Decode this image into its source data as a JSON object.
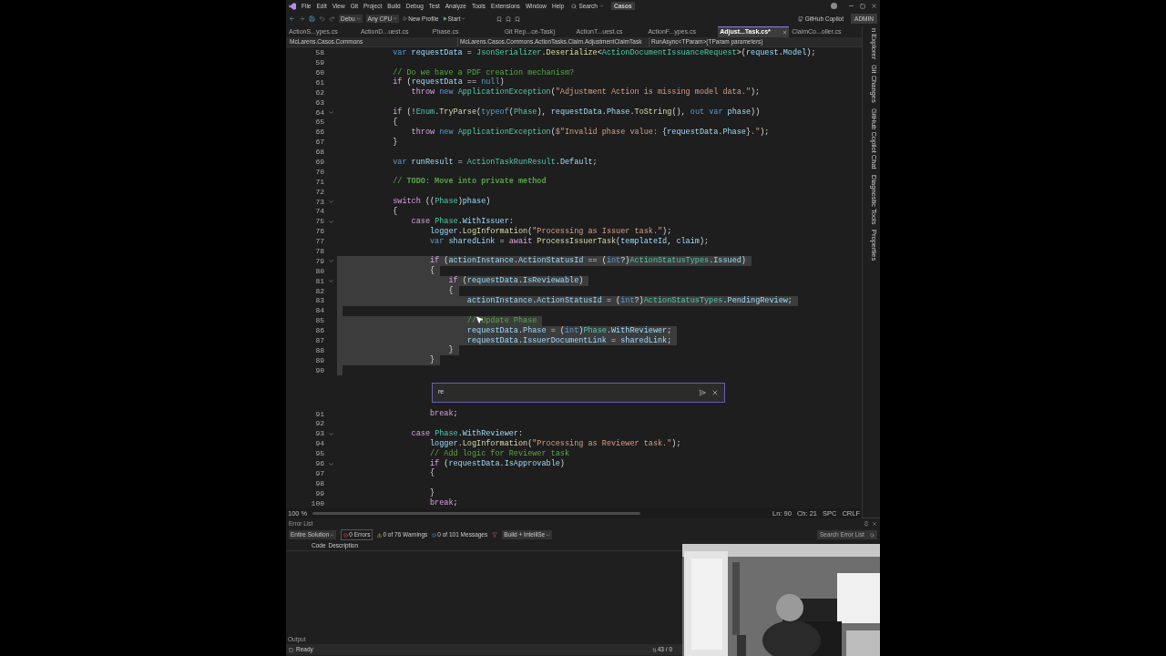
{
  "menu": [
    "File",
    "Edit",
    "View",
    "Git",
    "Project",
    "Build",
    "Debug",
    "Test",
    "Analyze",
    "Tools",
    "Extensions",
    "Window",
    "Help"
  ],
  "search": "Search",
  "solution_name": "Casos",
  "toolbar": {
    "configuration": "Debu",
    "platform": "Any CPU",
    "profile": "New Profile",
    "start": "Start",
    "copilot": "GitHub Copilot",
    "account": "ADMIN"
  },
  "tabs": [
    {
      "label": "ActionS...ypes.cs",
      "selected": false
    },
    {
      "label": "ActionD...uest.cs",
      "selected": false
    },
    {
      "label": "Phase.cs",
      "selected": false
    },
    {
      "label": "Git Rep...ce-Task)",
      "selected": false
    },
    {
      "label": "ActionT...uest.cs",
      "selected": false
    },
    {
      "label": "ActionF...ypes.cs",
      "selected": false
    },
    {
      "label": "Adjust...Task.cs*",
      "selected": true
    },
    {
      "label": "ClaimCo...oller.cs",
      "selected": false
    }
  ],
  "nav_bar": [
    "McLarens.Casos.Commons",
    "McLarens.Casos.Commons.ActionTasks.Claim.AdjustmentClaimTask",
    "RunAsync<TParam>(TParam parameters)"
  ],
  "editor": {
    "lines": [
      {
        "n": "58",
        "fold": false,
        "selected": false,
        "tokens": [
          {
            "kind": "kw",
            "text": "            var"
          },
          {
            "kind": "id",
            "text": " requestData"
          },
          {
            "kind": "pl",
            "text": " = "
          },
          {
            "kind": "type",
            "text": "JsonSerializer"
          },
          {
            "kind": "pl",
            "text": "."
          },
          {
            "kind": "fn",
            "text": "Deserialize"
          },
          {
            "kind": "pl",
            "text": "<"
          },
          {
            "kind": "type",
            "text": "ActionDocumentIssuanceRequest"
          },
          {
            "kind": "pl",
            "text": ">("
          },
          {
            "kind": "id",
            "text": "request"
          },
          {
            "kind": "pl",
            "text": "."
          },
          {
            "kind": "id",
            "text": "Model"
          },
          {
            "kind": "pl",
            "text": ");"
          }
        ]
      },
      {
        "n": "59",
        "fold": false,
        "selected": false
      },
      {
        "n": "60",
        "fold": false,
        "selected": false,
        "tokens": [
          {
            "kind": "com",
            "text": "            // Do we have a PDF creation mechanism?"
          }
        ]
      },
      {
        "n": "61",
        "fold": false,
        "selected": false,
        "tokens": [
          {
            "kind": "ctl",
            "text": "            if"
          },
          {
            "kind": "pl",
            "text": " ("
          },
          {
            "kind": "id",
            "text": "requestData"
          },
          {
            "kind": "pl",
            "text": " == "
          },
          {
            "kind": "kw",
            "text": "null"
          },
          {
            "kind": "pl",
            "text": ")"
          }
        ]
      },
      {
        "n": "62",
        "fold": false,
        "selected": false,
        "tokens": [
          {
            "kind": "ctl",
            "text": "                throw"
          },
          {
            "kind": "kw",
            "text": " new"
          },
          {
            "kind": "type",
            "text": " ApplicationException"
          },
          {
            "kind": "pl",
            "text": "("
          },
          {
            "kind": "str",
            "text": "\"Adjustment Action is missing model data.\""
          },
          {
            "kind": "pl",
            "text": ");"
          }
        ]
      },
      {
        "n": "63",
        "fold": false,
        "selected": false
      },
      {
        "n": "64",
        "fold": true,
        "selected": false,
        "tokens": [
          {
            "kind": "ctl",
            "text": "            if"
          },
          {
            "kind": "pl",
            "text": " (!"
          },
          {
            "kind": "type",
            "text": "Enum"
          },
          {
            "kind": "pl",
            "text": "."
          },
          {
            "kind": "fn",
            "text": "TryParse"
          },
          {
            "kind": "pl",
            "text": "("
          },
          {
            "kind": "kw",
            "text": "typeof"
          },
          {
            "kind": "pl",
            "text": "("
          },
          {
            "kind": "type",
            "text": "Phase"
          },
          {
            "kind": "pl",
            "text": "), "
          },
          {
            "kind": "id",
            "text": "requestData"
          },
          {
            "kind": "pl",
            "text": "."
          },
          {
            "kind": "id",
            "text": "Phase"
          },
          {
            "kind": "pl",
            "text": "."
          },
          {
            "kind": "fn",
            "text": "ToString"
          },
          {
            "kind": "pl",
            "text": "(), "
          },
          {
            "kind": "kw",
            "text": "out var"
          },
          {
            "kind": "id",
            "text": " phase"
          },
          {
            "kind": "pl",
            "text": "))"
          }
        ]
      },
      {
        "n": "65",
        "fold": false,
        "selected": false,
        "tokens": [
          {
            "kind": "pl",
            "text": "            {"
          }
        ]
      },
      {
        "n": "66",
        "fold": false,
        "selected": false,
        "tokens": [
          {
            "kind": "ctl",
            "text": "                throw"
          },
          {
            "kind": "kw",
            "text": " new"
          },
          {
            "kind": "type",
            "text": " ApplicationException"
          },
          {
            "kind": "pl",
            "text": "("
          },
          {
            "kind": "str",
            "text": "$\"Invalid phase value: "
          },
          {
            "kind": "pl",
            "text": "{"
          },
          {
            "kind": "id",
            "text": "requestData"
          },
          {
            "kind": "pl",
            "text": "."
          },
          {
            "kind": "id",
            "text": "Phase"
          },
          {
            "kind": "pl",
            "text": "}"
          },
          {
            "kind": "str",
            "text": ".\""
          },
          {
            "kind": "pl",
            "text": ");"
          }
        ]
      },
      {
        "n": "67",
        "fold": false,
        "selected": false,
        "tokens": [
          {
            "kind": "pl",
            "text": "            }"
          }
        ]
      },
      {
        "n": "68",
        "fold": false,
        "selected": false
      },
      {
        "n": "69",
        "fold": false,
        "selected": false,
        "tokens": [
          {
            "kind": "kw",
            "text": "            var"
          },
          {
            "kind": "id",
            "text": " runResult"
          },
          {
            "kind": "pl",
            "text": " = "
          },
          {
            "kind": "type",
            "text": "ActionTaskRunResult"
          },
          {
            "kind": "pl",
            "text": "."
          },
          {
            "kind": "id",
            "text": "Default"
          },
          {
            "kind": "pl",
            "text": ";"
          }
        ]
      },
      {
        "n": "70",
        "fold": false,
        "selected": false
      },
      {
        "n": "71",
        "fold": false,
        "selected": false,
        "tokens": [
          {
            "kind": "com",
            "text": "            // "
          },
          {
            "kind": "todo",
            "text": "TODO: Move into private method"
          }
        ]
      },
      {
        "n": "72",
        "fold": false,
        "selected": false
      },
      {
        "n": "73",
        "fold": true,
        "selected": false,
        "tokens": [
          {
            "kind": "ctl",
            "text": "            switch"
          },
          {
            "kind": "pl",
            "text": " (("
          },
          {
            "kind": "type",
            "text": "Phase"
          },
          {
            "kind": "pl",
            "text": ")"
          },
          {
            "kind": "id",
            "text": "phase"
          },
          {
            "kind": "pl",
            "text": ")"
          }
        ]
      },
      {
        "n": "74",
        "fold": false,
        "selected": false,
        "tokens": [
          {
            "kind": "pl",
            "text": "            {"
          }
        ]
      },
      {
        "n": "75",
        "fold": true,
        "selected": false,
        "tokens": [
          {
            "kind": "ctl",
            "text": "                case"
          },
          {
            "kind": "type",
            "text": " Phase"
          },
          {
            "kind": "pl",
            "text": "."
          },
          {
            "kind": "id",
            "text": "WithIssuer"
          },
          {
            "kind": "pl",
            "text": ":"
          }
        ]
      },
      {
        "n": "76",
        "fold": false,
        "selected": false,
        "tokens": [
          {
            "kind": "id",
            "text": "                    logger"
          },
          {
            "kind": "pl",
            "text": "."
          },
          {
            "kind": "fn",
            "text": "LogInformation"
          },
          {
            "kind": "pl",
            "text": "("
          },
          {
            "kind": "str",
            "text": "\"Processing as Issuer task.\""
          },
          {
            "kind": "pl",
            "text": ");"
          }
        ]
      },
      {
        "n": "77",
        "fold": false,
        "selected": false,
        "tokens": [
          {
            "kind": "kw",
            "text": "                    var"
          },
          {
            "kind": "id",
            "text": " sharedLink"
          },
          {
            "kind": "pl",
            "text": " = "
          },
          {
            "kind": "ctl",
            "text": "await"
          },
          {
            "kind": "fn",
            "text": " ProcessIssuerTask"
          },
          {
            "kind": "pl",
            "text": "("
          },
          {
            "kind": "id",
            "text": "templateId"
          },
          {
            "kind": "pl",
            "text": ", "
          },
          {
            "kind": "id",
            "text": "claim"
          },
          {
            "kind": "pl",
            "text": ");"
          }
        ]
      },
      {
        "n": "78",
        "fold": false,
        "selected": false
      },
      {
        "n": "79",
        "fold": true,
        "selected": true,
        "tokens": [
          {
            "kind": "ctl",
            "text": "                    if"
          },
          {
            "kind": "pl",
            "text": " ("
          },
          {
            "kind": "id",
            "text": "actionInstance"
          },
          {
            "kind": "pl",
            "text": "."
          },
          {
            "kind": "id",
            "text": "ActionStatusId"
          },
          {
            "kind": "pl",
            "text": " == ("
          },
          {
            "kind": "kw",
            "text": "int"
          },
          {
            "kind": "pl",
            "text": "?)"
          },
          {
            "kind": "type",
            "text": "ActionStatusTypes"
          },
          {
            "kind": "pl",
            "text": "."
          },
          {
            "kind": "id",
            "text": "Issued"
          },
          {
            "kind": "pl",
            "text": ")"
          }
        ]
      },
      {
        "n": "80",
        "fold": false,
        "selected": true,
        "tokens": [
          {
            "kind": "pl",
            "text": "                    {"
          }
        ]
      },
      {
        "n": "81",
        "fold": true,
        "selected": true,
        "tokens": [
          {
            "kind": "ctl",
            "text": "                        if"
          },
          {
            "kind": "pl",
            "text": " ("
          },
          {
            "kind": "id",
            "text": "requestData"
          },
          {
            "kind": "pl",
            "text": "."
          },
          {
            "kind": "id",
            "text": "IsReviewable"
          },
          {
            "kind": "pl",
            "text": ")"
          }
        ]
      },
      {
        "n": "82",
        "fold": false,
        "selected": true,
        "tokens": [
          {
            "kind": "pl",
            "text": "                        {"
          }
        ]
      },
      {
        "n": "83",
        "fold": false,
        "selected": true,
        "tokens": [
          {
            "kind": "id",
            "text": "                            actionInstance"
          },
          {
            "kind": "pl",
            "text": "."
          },
          {
            "kind": "id",
            "text": "ActionStatusId"
          },
          {
            "kind": "pl",
            "text": " = ("
          },
          {
            "kind": "kw",
            "text": "int"
          },
          {
            "kind": "pl",
            "text": "?)"
          },
          {
            "kind": "type",
            "text": "ActionStatusTypes"
          },
          {
            "kind": "pl",
            "text": "."
          },
          {
            "kind": "id",
            "text": "PendingReview"
          },
          {
            "kind": "pl",
            "text": ";"
          }
        ]
      },
      {
        "n": "84",
        "fold": false,
        "selected": true
      },
      {
        "n": "85",
        "fold": false,
        "selected": true,
        "tokens": [
          {
            "kind": "com",
            "text": "                            // Update Phase"
          }
        ]
      },
      {
        "n": "86",
        "fold": false,
        "selected": true,
        "tokens": [
          {
            "kind": "id",
            "text": "                            requestData"
          },
          {
            "kind": "pl",
            "text": "."
          },
          {
            "kind": "id",
            "text": "Phase"
          },
          {
            "kind": "pl",
            "text": " = ("
          },
          {
            "kind": "kw",
            "text": "int"
          },
          {
            "kind": "pl",
            "text": ")"
          },
          {
            "kind": "type",
            "text": "Phase"
          },
          {
            "kind": "pl",
            "text": "."
          },
          {
            "kind": "id",
            "text": "WithReviewer"
          },
          {
            "kind": "pl",
            "text": ";"
          }
        ]
      },
      {
        "n": "87",
        "fold": false,
        "selected": true,
        "tokens": [
          {
            "kind": "id",
            "text": "                            requestData"
          },
          {
            "kind": "pl",
            "text": "."
          },
          {
            "kind": "id",
            "text": "IssuerDocumentLink"
          },
          {
            "kind": "pl",
            "text": " = "
          },
          {
            "kind": "id",
            "text": "sharedLink"
          },
          {
            "kind": "pl",
            "text": ";"
          }
        ]
      },
      {
        "n": "88",
        "fold": false,
        "selected": true,
        "tokens": [
          {
            "kind": "pl",
            "text": "                        }"
          }
        ]
      },
      {
        "n": "89",
        "fold": false,
        "selected": true,
        "tokens": [
          {
            "kind": "pl",
            "text": "                    }"
          }
        ]
      },
      {
        "n": "90",
        "fold": false,
        "selected": true
      }
    ],
    "inline_chat": {
      "value": "re"
    },
    "lines_after": [
      {
        "n": "91",
        "fold": false,
        "selected": false,
        "tokens": [
          {
            "kind": "ctl",
            "text": "                    break"
          },
          {
            "kind": "pl",
            "text": ";"
          }
        ]
      },
      {
        "n": "92",
        "fold": false,
        "selected": false
      },
      {
        "n": "93",
        "fold": true,
        "selected": false,
        "tokens": [
          {
            "kind": "ctl",
            "text": "                case"
          },
          {
            "kind": "type",
            "text": " Phase"
          },
          {
            "kind": "pl",
            "text": "."
          },
          {
            "kind": "id",
            "text": "WithReviewer"
          },
          {
            "kind": "pl",
            "text": ":"
          }
        ]
      },
      {
        "n": "94",
        "fold": false,
        "selected": false,
        "tokens": [
          {
            "kind": "id",
            "text": "                    logger"
          },
          {
            "kind": "pl",
            "text": "."
          },
          {
            "kind": "fn",
            "text": "LogInformation"
          },
          {
            "kind": "pl",
            "text": "("
          },
          {
            "kind": "str",
            "text": "\"Processing as Reviewer task.\""
          },
          {
            "kind": "pl",
            "text": ");"
          }
        ]
      },
      {
        "n": "95",
        "fold": false,
        "selected": false,
        "tokens": [
          {
            "kind": "com",
            "text": "                    // Add logic for Reviewer task"
          }
        ]
      },
      {
        "n": "96",
        "fold": true,
        "selected": false,
        "tokens": [
          {
            "kind": "ctl",
            "text": "                    if"
          },
          {
            "kind": "pl",
            "text": " ("
          },
          {
            "kind": "id",
            "text": "requestData"
          },
          {
            "kind": "pl",
            "text": "."
          },
          {
            "kind": "id",
            "text": "IsApprovable"
          },
          {
            "kind": "pl",
            "text": ")"
          }
        ]
      },
      {
        "n": "97",
        "fold": false,
        "selected": false,
        "tokens": [
          {
            "kind": "pl",
            "text": "                    {"
          }
        ]
      },
      {
        "n": "98",
        "fold": false,
        "selected": false
      },
      {
        "n": "99",
        "fold": false,
        "selected": false,
        "tokens": [
          {
            "kind": "pl",
            "text": "                    }"
          }
        ]
      },
      {
        "n": "100",
        "fold": false,
        "selected": false,
        "tokens": [
          {
            "kind": "ctl",
            "text": "                    break"
          },
          {
            "kind": "pl",
            "text": ";"
          }
        ]
      }
    ],
    "status": {
      "zoom": "100 %",
      "line": "Ln: 90",
      "column": "Ch: 21",
      "indent": "SPC",
      "eol": "CRLF"
    }
  },
  "side_tabs": [
    "n Explorer",
    "Git Changes",
    "GitHub Copilot Chat",
    "Diagnostic Tools",
    "Properties"
  ],
  "error_list": {
    "title": "Error List",
    "scope": "Entire Solution",
    "errors": "0 Errors",
    "warnings": "0 of 76 Warnings",
    "messages": "0 of 101 Messages",
    "source": "Build + IntelliSe",
    "search_placeholder": "Search Error List",
    "columns": [
      "Code",
      "Description"
    ]
  },
  "output_tab": "Output",
  "status_bar": {
    "text": "Ready",
    "changes": "43 / 0"
  },
  "webcam": {
    "kind": "picture"
  }
}
